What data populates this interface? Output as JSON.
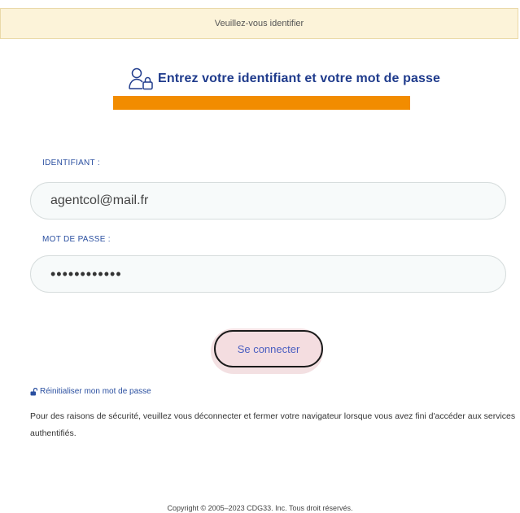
{
  "banner": {
    "text": "Veuillez-vous identifier"
  },
  "header": {
    "title": "Entrez votre identifiant et votre mot de passe",
    "icon": "user-lock-icon"
  },
  "colors": {
    "accent": "#f28c00",
    "title": "#1f3b8c",
    "link": "#2a4fa0",
    "banner_bg": "#fcf3d9",
    "button_bg": "#f4dde0"
  },
  "form": {
    "username_label": "IDENTIFIANT :",
    "username_value": "agentcol@mail.fr",
    "password_label": "MOT DE PASSE :",
    "password_value": "••••••••••••",
    "submit_label": "Se connecter"
  },
  "links": {
    "reset_password": "Réinitialiser mon mot de passe"
  },
  "notice": "Pour des raisons de sécurité, veuillez vous déconnecter et fermer votre navigateur lorsque vous avez fini d'accéder aux services authentifiés.",
  "footer": {
    "copyright": "Copyright © 2005–2023 CDG33. Inc. Tous droit réservés."
  }
}
